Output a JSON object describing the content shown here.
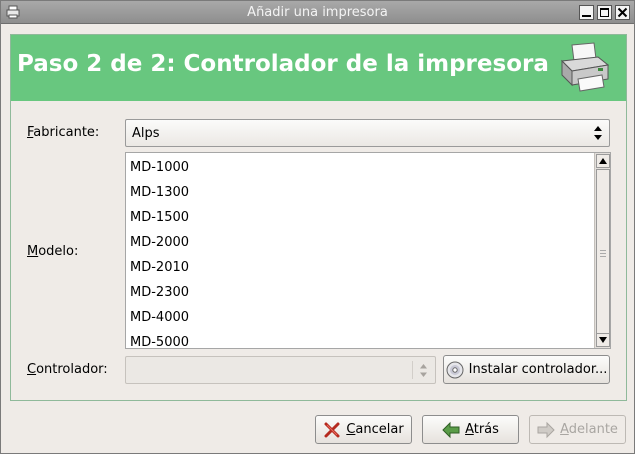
{
  "window": {
    "title": "Añadir una impresora"
  },
  "header": {
    "heading": "Paso 2 de 2: Controlador de la impresora"
  },
  "fabricante": {
    "label_first": "F",
    "label_rest": "abricante:",
    "value": "Alps"
  },
  "modelo": {
    "label_first": "M",
    "label_rest": "odelo:",
    "items": [
      "MD-1000",
      "MD-1300",
      "MD-1500",
      "MD-2000",
      "MD-2010",
      "MD-2300",
      "MD-4000",
      "MD-5000"
    ]
  },
  "controlador": {
    "label_first": "C",
    "label_rest": "ontrolador:",
    "value": ""
  },
  "buttons": {
    "install": "Instalar controlador...",
    "cancel_first": "C",
    "cancel_rest": "ancelar",
    "back_first": "A",
    "back_rest": "trás",
    "next_first": "A",
    "next_rest": "delante"
  },
  "colors": {
    "header_bg": "#68c77f",
    "window_bg": "#efebe7",
    "titlebar": "#999999"
  },
  "icons": [
    "app-icon",
    "minimize-icon",
    "maximize-icon",
    "close-icon",
    "printer-icon",
    "cd-icon",
    "cancel-x-icon",
    "back-arrow-icon",
    "forward-arrow-icon"
  ]
}
